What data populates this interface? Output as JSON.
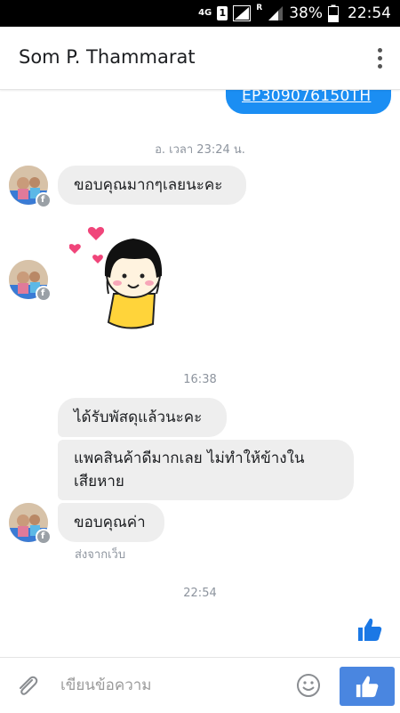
{
  "status_bar": {
    "network": "4G",
    "sim": "1",
    "roaming": "R",
    "battery": "38%",
    "time": "22:54"
  },
  "header": {
    "contact_name": "Som P. Thammarat",
    "menu_icon": "more-vertical-icon"
  },
  "messages": {
    "outgoing_tracking": "EP309076150TH",
    "time_1": "อ. เวลา 23:24 น.",
    "msg_thanks_1": "ขอบคุณมากๆเลยนะคะ",
    "time_2": "16:38",
    "msg_received": "ได้รับพัสดุแล้วนะคะ",
    "msg_packing_line1": "แพคสินค้าดีมากเลย ไม่ทำให้ข้างใน",
    "msg_packing_line2": "เสียหาย",
    "msg_thanks_2": "ขอบคุณค่า",
    "sent_from": "ส่งจากเว็บ",
    "time_3": "22:54"
  },
  "composer": {
    "placeholder": "เขียนข้อความ"
  },
  "colors": {
    "outgoing_bubble": "#1b8ef3",
    "incoming_bubble": "#eeeeee",
    "like_button": "#4a86e0",
    "like_icon": "#1b78e5"
  }
}
